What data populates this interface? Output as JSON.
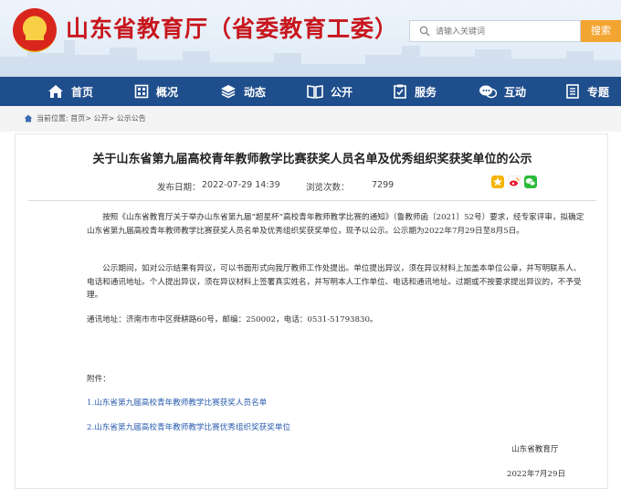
{
  "site": {
    "title": "山东省教育厅（省委教育工委）"
  },
  "search": {
    "placeholder": "请输入关键词",
    "button_label": "搜索"
  },
  "nav": {
    "items": [
      {
        "label": "首页",
        "icon": "home-icon"
      },
      {
        "label": "概况",
        "icon": "building-icon"
      },
      {
        "label": "动态",
        "icon": "layers-icon"
      },
      {
        "label": "公开",
        "icon": "book-icon"
      },
      {
        "label": "服务",
        "icon": "clipboard-icon"
      },
      {
        "label": "互动",
        "icon": "chat-icon"
      },
      {
        "label": "专题",
        "icon": "document-icon"
      }
    ]
  },
  "breadcrumb": {
    "text": "当前位置: 首页> 公开> 公示公告"
  },
  "article": {
    "title": "关于山东省第九届高校青年教师教学比赛获奖人员名单及优秀组织奖获奖单位的公示",
    "date_label": "发布日期：",
    "date": "2022-07-29 14:39",
    "views_label": "浏览次数：",
    "views": "7299",
    "para1": "按照《山东省教育厅关于举办山东省第九届“超星杯”高校青年教师教学比赛的通知》（鲁教师函〔2021〕52号）要求，经专家评审，拟确定山东省第九届高校青年教师教学比赛获奖人员名单及优秀组织奖获奖单位，现予以公示。公示期为2022年7月29日至8月5日。",
    "para2": "公示期间，如对公示结果有异议，可以书面形式向我厅教师工作处提出。单位提出异议，须在异议材料上加盖本单位公章，并写明联系人、电话和通讯地址。个人提出异议，须在异议材料上签署真实姓名，并写明本人工作单位、电话和通讯地址。过期或不按要求提出异议的，不予受理。",
    "address": "通讯地址：济南市市中区舜耕路60号，邮编：250002，电话：0531-51793830。",
    "attachments_label": "附件：",
    "attachment1": "1.山东省第九届高校青年教师教学比赛获奖人员名单",
    "attachment2": "2.山东省第九届高校青年教师教学比赛优秀组织奖获奖单位",
    "signature": "山东省教育厅",
    "sign_date": "2022年7月29日"
  },
  "colors": {
    "brand_red": "#c8161d",
    "nav_blue": "#1f4e8c",
    "search_orange": "#f3a532",
    "link_blue": "#2a5db0"
  }
}
